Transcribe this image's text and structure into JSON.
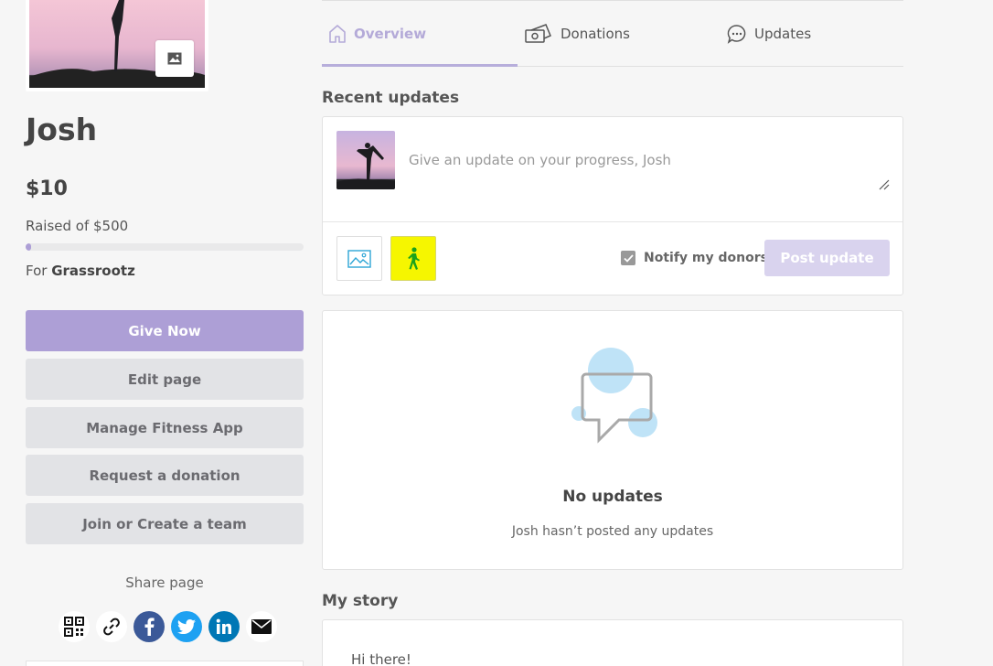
{
  "profile": {
    "name": "Josh",
    "amount_raised": "$10",
    "raised_of": "Raised of $500",
    "progress_percent": 2,
    "for_prefix": "For",
    "charity": "Grassrootz"
  },
  "actions": {
    "give_now": "Give Now",
    "edit_page": "Edit page",
    "manage_fitness": "Manage Fitness App",
    "request_donation": "Request a donation",
    "join_team": "Join or Create a team"
  },
  "share": {
    "label": "Share page",
    "icons": [
      "qr-code-icon",
      "link-icon",
      "facebook-icon",
      "twitter-icon",
      "linkedin-icon",
      "email-icon"
    ]
  },
  "tabs": [
    {
      "label": "Overview",
      "icon": "home-icon",
      "active": true
    },
    {
      "label": "Donations",
      "icon": "money-icon",
      "active": false
    },
    {
      "label": "Updates",
      "icon": "chat-icon",
      "active": false
    }
  ],
  "recent_updates": {
    "title": "Recent updates",
    "placeholder": "Give an update on your progress, Josh",
    "notify_label": "Notify my donors",
    "notify_checked": true,
    "post_button": "Post update"
  },
  "empty_state": {
    "title": "No updates",
    "subtitle": "Josh hasn’t posted any updates"
  },
  "story": {
    "title": "My story",
    "text": "Hi there!"
  },
  "colors": {
    "accent": "#ad9fd6",
    "accent_light": "#d9d3ee",
    "highlight": "#f6f600",
    "facebook": "#3b5998",
    "twitter": "#1da1f2",
    "linkedin": "#0077b5"
  }
}
